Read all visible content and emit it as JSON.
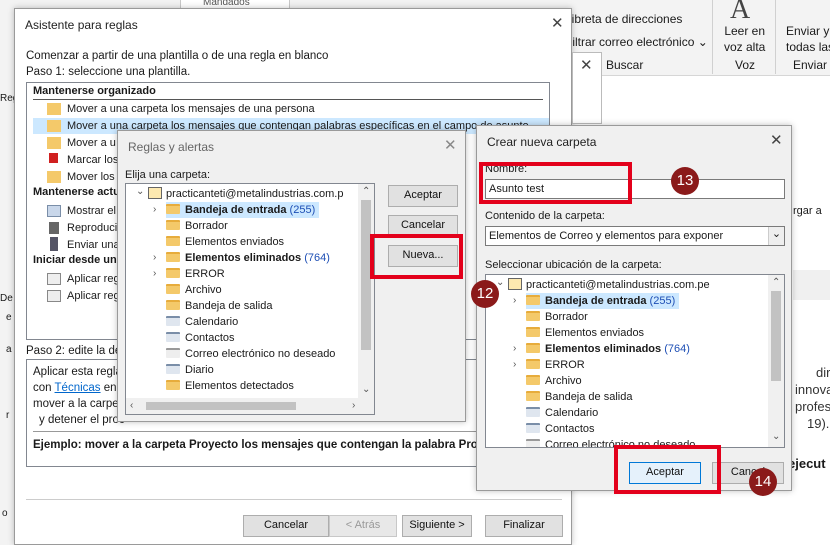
{
  "ribbon": {
    "address_book": "Libreta de direcciones",
    "filter_email": "Filtrar correo electrónico",
    "search_group": "Buscar",
    "read_aloud_line1": "Leer en",
    "read_aloud_line2": "voz alta",
    "voice_group": "Voz",
    "send_all_line1": "Enviar y",
    "send_all_line2": "todas las",
    "send_group": "Enviar y",
    "top_tab_fragment": "Mandados",
    "side_text": "rgar a",
    "doc_lines": [
      "dirig",
      "innova",
      "profes",
      "19)."
    ],
    "doc_bold": "ejecut"
  },
  "background_left": {
    "labels": [
      "Regl",
      "De",
      "e",
      "a",
      "r",
      "o"
    ]
  },
  "wizard": {
    "title": "Asistente para reglas",
    "intro": "Comenzar a partir de una plantilla o de una regla en blanco",
    "step1": "Paso 1: seleccione una plantilla.",
    "sections": [
      {
        "header": "Mantenerse organizado",
        "rules": [
          "Mover a una carpeta los mensajes de una persona",
          "Mover a una carpeta los mensajes que contengan palabras específicas en el campo de asunto",
          "Mover a u",
          "Marcar los",
          "Mover los"
        ]
      },
      {
        "header": "Mantenerse actu",
        "rules": [
          "Mostrar el",
          "Reproduci",
          "Enviar una"
        ]
      },
      {
        "header": "Iniciar desde una",
        "rules": [
          "Aplicar regl",
          "Aplicar regl"
        ]
      }
    ],
    "step2": "Paso 2: edite la de",
    "desc_lines": [
      "Aplicar esta regla",
      "con ",
      "Técnicas",
      " en",
      "mover a la carpet",
      "y detener el proc"
    ],
    "example": "Ejemplo: mover a la carpeta Proyecto los mensajes que contengan la palabra Proyecto",
    "buttons": {
      "cancel": "Cancelar",
      "back": "< Atrás",
      "next": "Siguiente >",
      "finish": "Finalizar"
    }
  },
  "rules_alerts": {
    "title": "Reglas y alertas",
    "choose": "Elija una carpeta:",
    "account": "practicanteti@metalindustrias.com.p",
    "folders": [
      {
        "name": "Bandeja de entrada",
        "count": "(255)",
        "bold": true
      },
      {
        "name": "Borrador"
      },
      {
        "name": "Elementos enviados"
      },
      {
        "name": "Elementos eliminados",
        "count": "(764)",
        "bold": true
      },
      {
        "name": "ERROR"
      },
      {
        "name": "Archivo"
      },
      {
        "name": "Bandeja de salida"
      },
      {
        "name": "Calendario"
      },
      {
        "name": "Contactos"
      },
      {
        "name": "Correo electrónico no deseado"
      },
      {
        "name": "Diario"
      },
      {
        "name": "Elementos detectados"
      }
    ],
    "buttons": {
      "accept": "Aceptar",
      "cancel": "Cancelar",
      "new": "Nueva..."
    }
  },
  "new_folder": {
    "title": "Crear nueva carpeta",
    "name_label": "Nombre:",
    "name_value": "Asunto test",
    "contents_label": "Contenido de la carpeta:",
    "contents_value": "Elementos de Correo y elementos para exponer",
    "location_label": "Seleccionar ubicación de la carpeta:",
    "account": "practicanteti@metalindustrias.com.pe",
    "folders": [
      {
        "name": "Bandeja de entrada",
        "count": "(255)",
        "bold": true
      },
      {
        "name": "Borrador"
      },
      {
        "name": "Elementos enviados"
      },
      {
        "name": "Elementos eliminados",
        "count": "(764)",
        "bold": true
      },
      {
        "name": "ERROR"
      },
      {
        "name": "Archivo"
      },
      {
        "name": "Bandeja de salida"
      },
      {
        "name": "Calendario"
      },
      {
        "name": "Contactos"
      },
      {
        "name": "Correo electrónico no deseado"
      }
    ],
    "buttons": {
      "accept": "Aceptar",
      "cancel": "Cancel"
    }
  },
  "badges": {
    "b12": "12",
    "b13": "13",
    "b14": "14"
  },
  "colors": {
    "highlight": "#e3001b",
    "badge": "#8b1a1a",
    "selection": "#cce8ff"
  }
}
